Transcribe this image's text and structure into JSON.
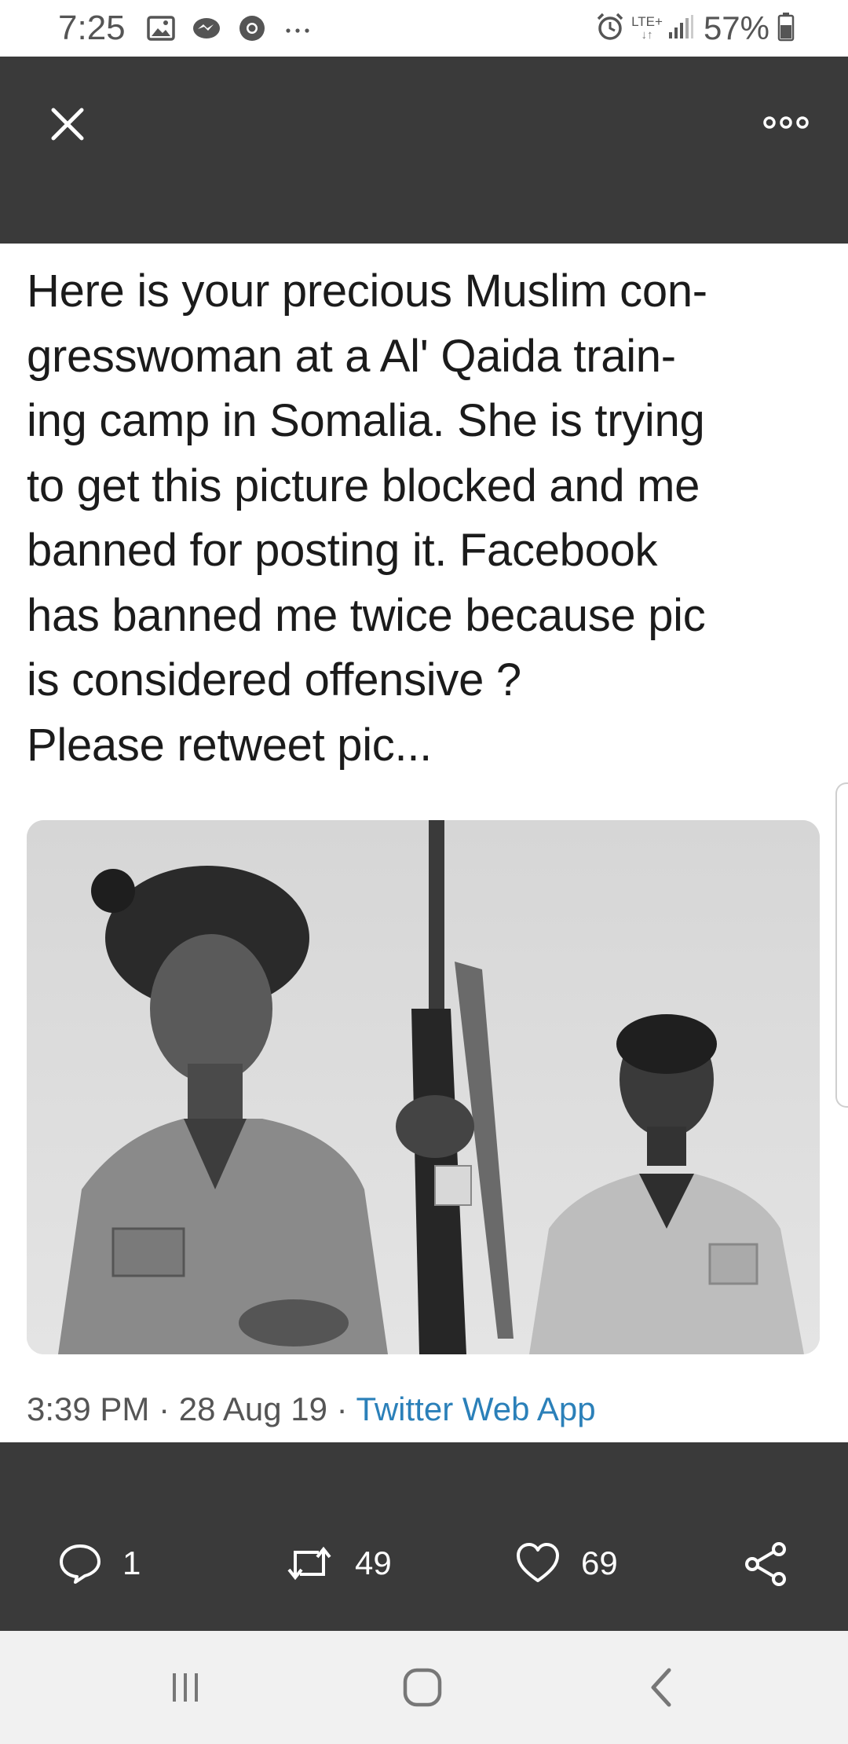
{
  "status_bar": {
    "time": "7:25",
    "network": "LTE+",
    "battery": "57%",
    "icons": [
      "gallery-icon",
      "messenger-icon",
      "chrome-icon",
      "more-dots-icon",
      "alarm-icon",
      "signal-icon",
      "battery-icon"
    ]
  },
  "top_bar": {
    "close_icon": "close-icon",
    "more_icon": "more-options-icon"
  },
  "tweet": {
    "text": "Here is your precious Muslim con-\ngresswoman at a Al' Qaida train-\ning camp in Somalia. She is trying\nto get this picture blocked and me\nbanned for posting it. Facebook\nhas banned me twice because pic\nis considered  offensive ?\nPlease retweet pic...",
    "meta": {
      "time": "3:39 PM",
      "date": "28 Aug 19",
      "source": "Twitter Web App"
    }
  },
  "actions": {
    "replies": "1",
    "retweets": "49",
    "likes": "69"
  },
  "colors": {
    "dark_bar": "#3a3a3a",
    "source_link": "#2b80b9",
    "text": "#1b1b1b"
  }
}
